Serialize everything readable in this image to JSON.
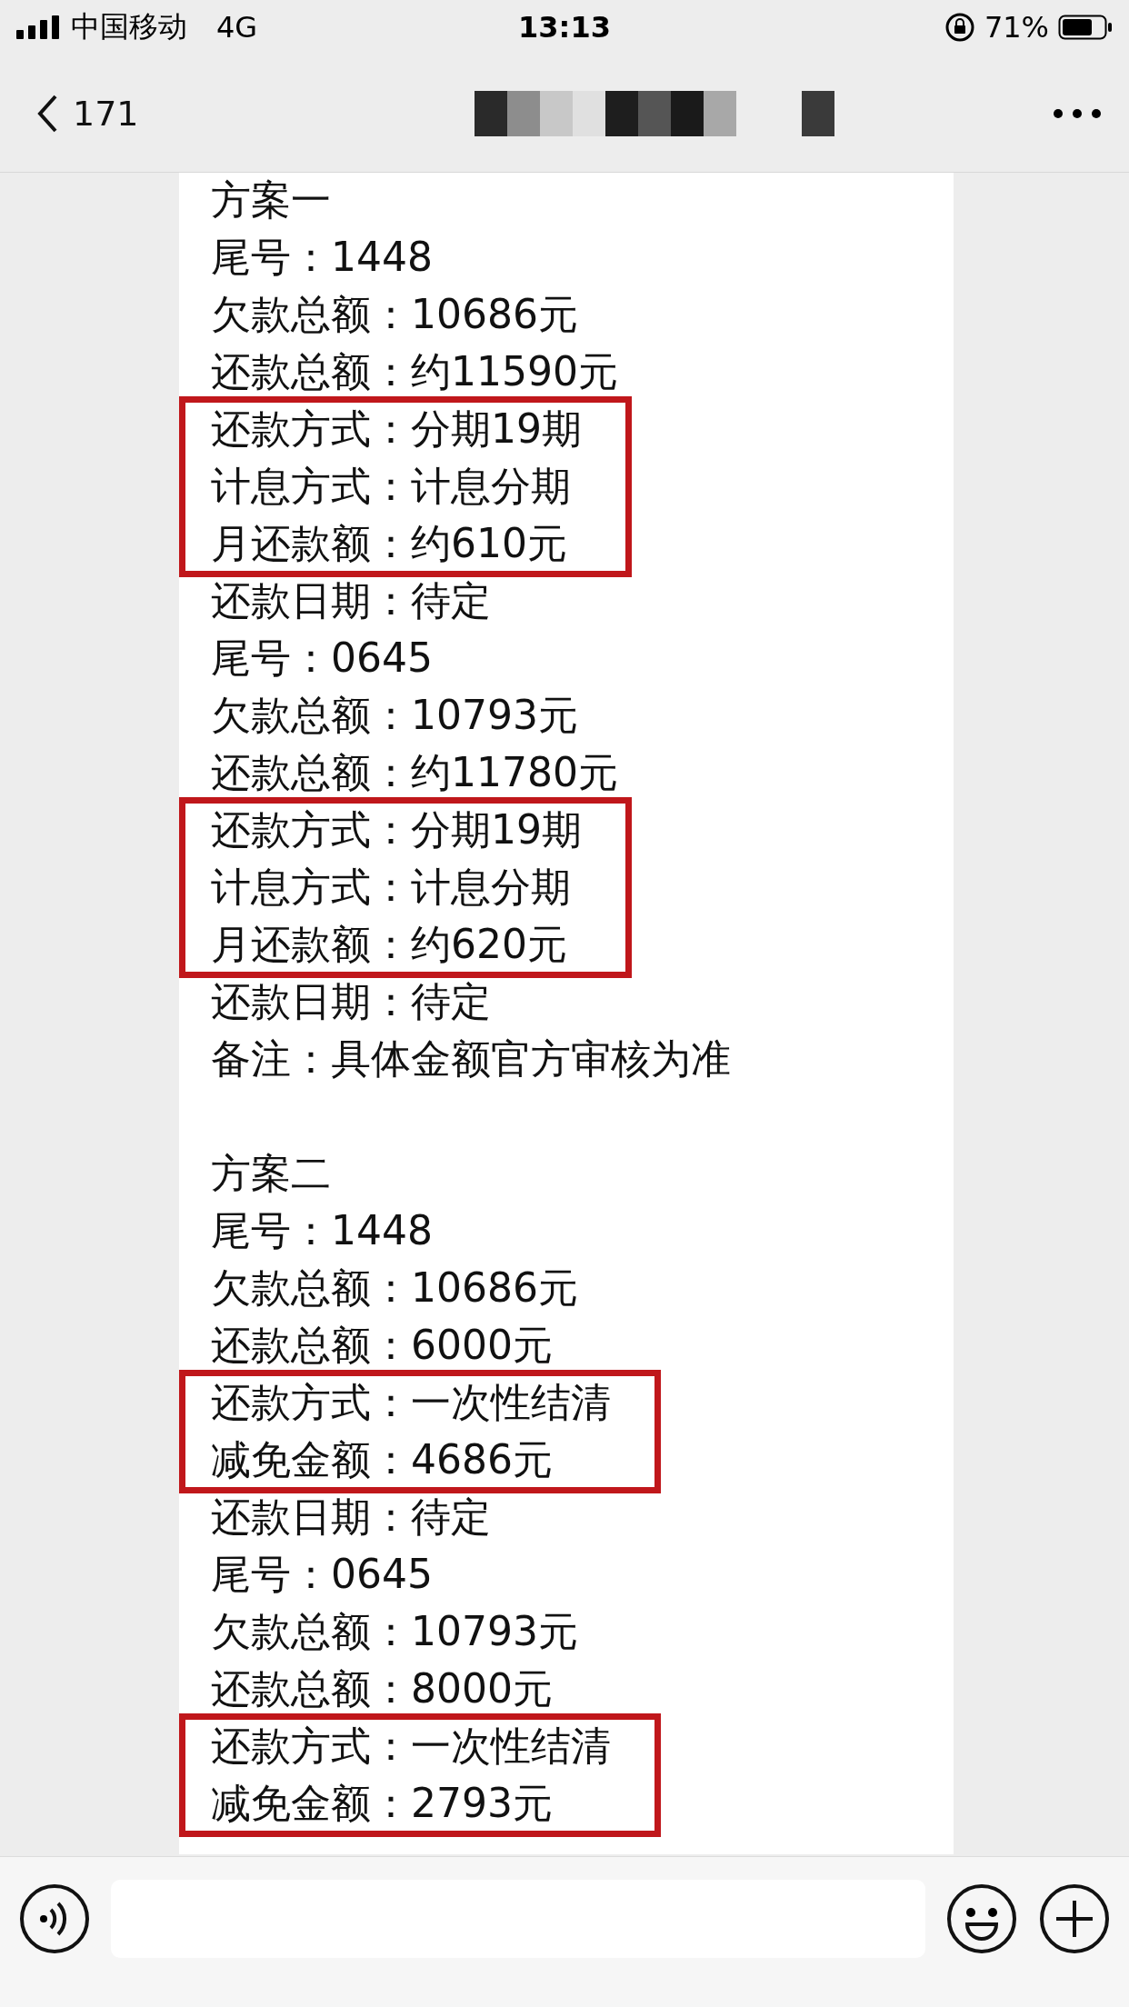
{
  "status_bar": {
    "carrier": "中国移动",
    "network": "4G",
    "time": "13:13",
    "battery": "71%"
  },
  "nav": {
    "back_count": "171"
  },
  "message": {
    "blocks": [
      {
        "highlighted": false,
        "spaced": false,
        "lines": [
          "方案一",
          "尾号：1448",
          "欠款总额：10686元",
          "还款总额：约11590元"
        ]
      },
      {
        "highlighted": true,
        "spaced": false,
        "lines": [
          "还款方式：分期19期",
          "计息方式：计息分期",
          "月还款额：约610元"
        ]
      },
      {
        "highlighted": false,
        "spaced": false,
        "lines": [
          "还款日期：待定",
          "尾号：0645",
          "欠款总额：10793元",
          "还款总额：约11780元"
        ]
      },
      {
        "highlighted": true,
        "spaced": false,
        "lines": [
          "还款方式：分期19期",
          "计息方式：计息分期",
          "月还款额：约620元"
        ]
      },
      {
        "highlighted": false,
        "spaced": false,
        "lines": [
          "还款日期：待定",
          "备注：具体金额官方审核为准"
        ]
      },
      {
        "highlighted": false,
        "spaced": true,
        "lines": [
          "方案二",
          "尾号：1448",
          "欠款总额：10686元",
          "还款总额：6000元"
        ]
      },
      {
        "highlighted": true,
        "spaced": false,
        "lines": [
          "还款方式：一次性结清",
          "减免金额：4686元"
        ]
      },
      {
        "highlighted": false,
        "spaced": false,
        "lines": [
          "还款日期：待定",
          "尾号：0645",
          "欠款总额：10793元",
          "还款总额：8000元"
        ]
      },
      {
        "highlighted": true,
        "spaced": false,
        "lines": [
          "还款方式：一次性结清",
          "减免金额：2793元"
        ]
      }
    ]
  }
}
